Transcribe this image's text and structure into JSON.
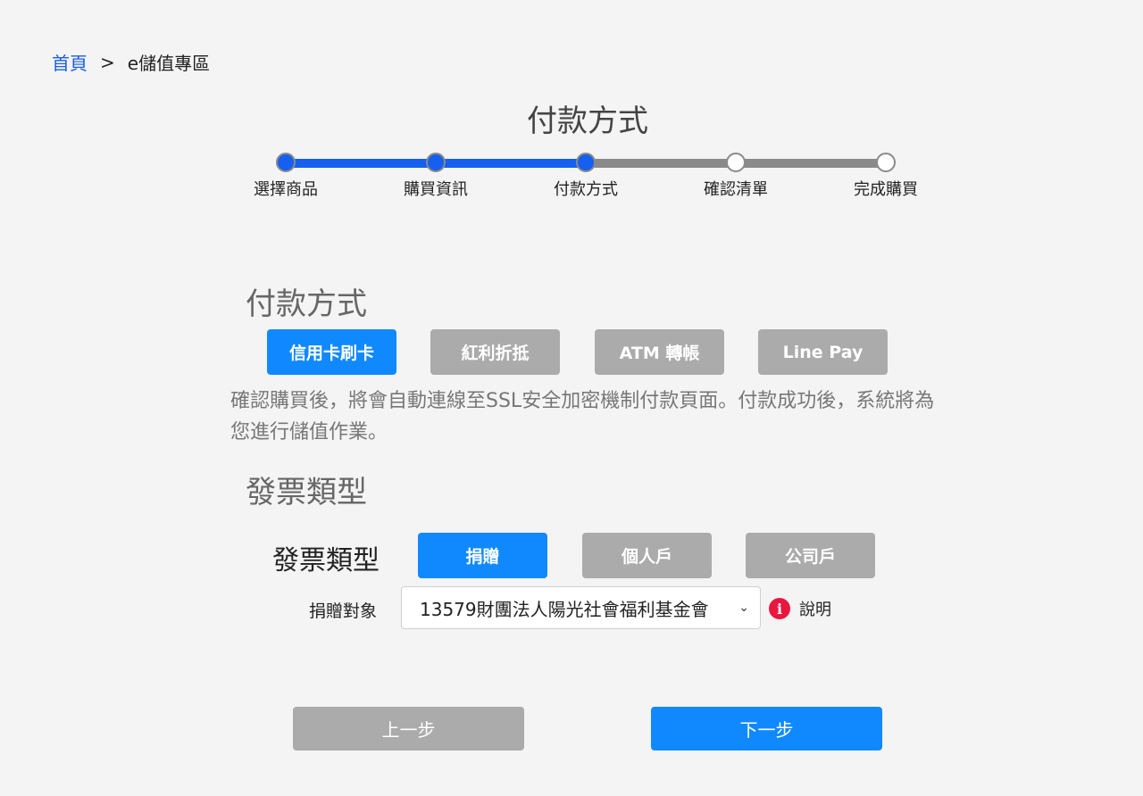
{
  "breadcrumb": {
    "home": "首頁",
    "separator": ">",
    "current": "e儲值專區"
  },
  "page_title": "付款方式",
  "stepper": {
    "current_index": 2,
    "steps": [
      {
        "label": "選擇商品",
        "state": "done"
      },
      {
        "label": "購買資訊",
        "state": "done"
      },
      {
        "label": "付款方式",
        "state": "current"
      },
      {
        "label": "確認清單",
        "state": "todo"
      },
      {
        "label": "完成購買",
        "state": "todo"
      }
    ]
  },
  "payment": {
    "section_title": "付款方式",
    "options": [
      {
        "label": "信用卡刷卡",
        "selected": true
      },
      {
        "label": "紅利折抵",
        "selected": false
      },
      {
        "label": "ATM 轉帳",
        "selected": false
      },
      {
        "label": "Line Pay",
        "selected": false
      }
    ],
    "description": "確認購買後，將會自動連線至SSL安全加密機制付款頁面。付款成功後，系統將為您進行儲值作業。"
  },
  "invoice": {
    "section_title": "發票類型",
    "type_label": "發票類型",
    "options": [
      {
        "label": "捐贈",
        "selected": true
      },
      {
        "label": "個人戶",
        "selected": false
      },
      {
        "label": "公司戶",
        "selected": false
      }
    ],
    "donee_label": "捐贈對象",
    "donee_selected": "13579財團法人陽光社會福利基金會",
    "info_icon": "exclamation-icon",
    "info_text": "說明"
  },
  "navigation": {
    "prev_label": "上一步",
    "next_label": "下一步"
  },
  "colors": {
    "accent": "#1089ff",
    "step_done": "#1560ee",
    "inactive": "#ababab",
    "info": "#e8173f",
    "link": "#1a5fe6"
  }
}
